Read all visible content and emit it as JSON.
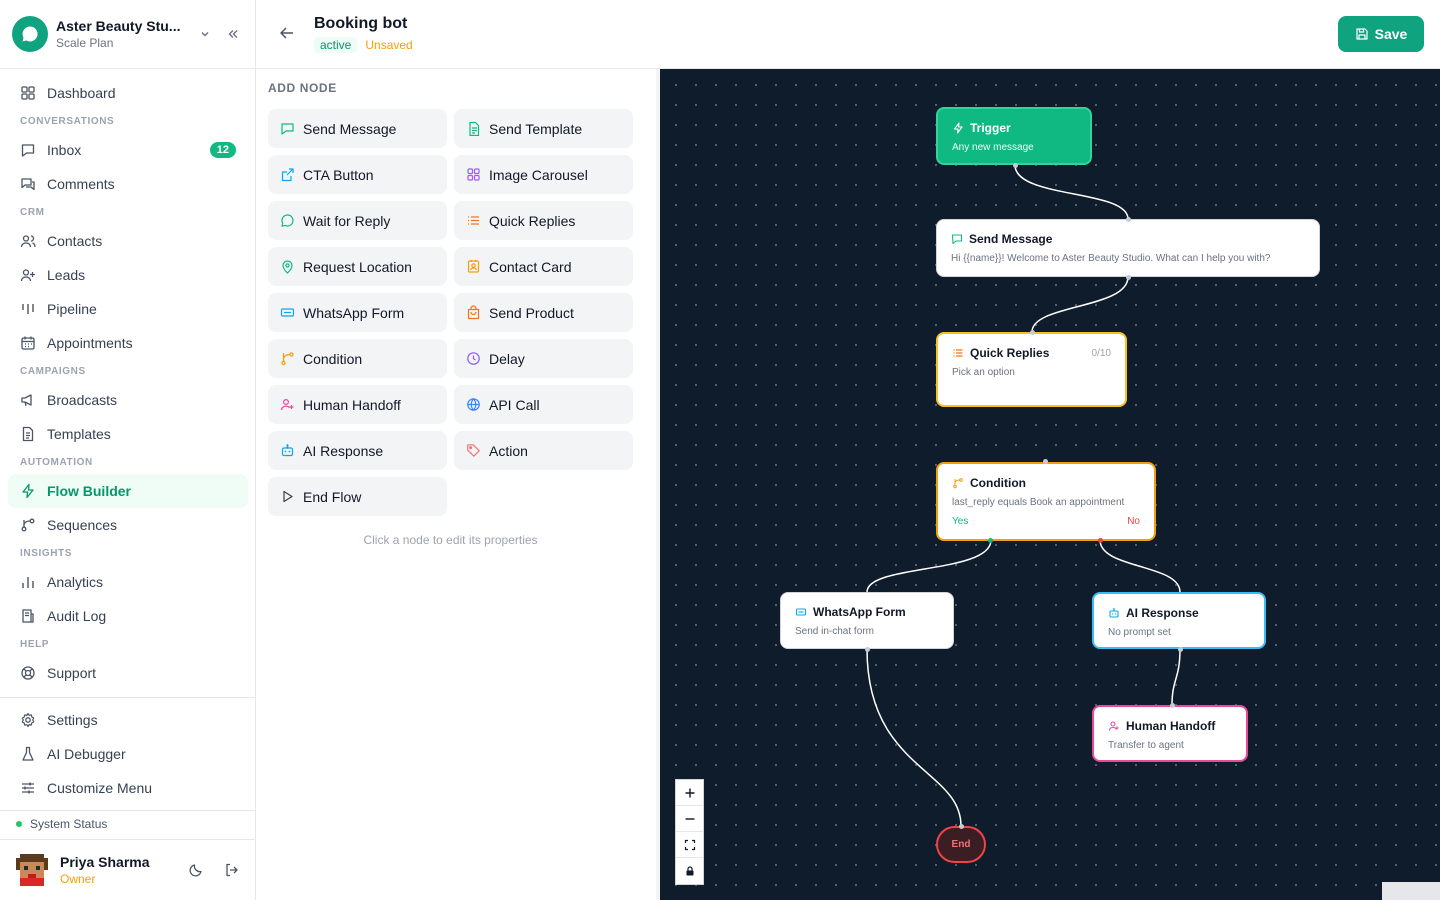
{
  "workspace": {
    "name": "Aster Beauty Stu...",
    "plan": "Scale Plan"
  },
  "nav": {
    "dashboard": "Dashboard",
    "sec_conversations": "CONVERSATIONS",
    "inbox": "Inbox",
    "inbox_badge": "12",
    "comments": "Comments",
    "sec_crm": "CRM",
    "contacts": "Contacts",
    "leads": "Leads",
    "pipeline": "Pipeline",
    "appointments": "Appointments",
    "sec_campaigns": "CAMPAIGNS",
    "broadcasts": "Broadcasts",
    "templates": "Templates",
    "sec_automation": "AUTOMATION",
    "flow_builder": "Flow Builder",
    "sequences": "Sequences",
    "sec_insights": "INSIGHTS",
    "analytics": "Analytics",
    "audit_log": "Audit Log",
    "sec_help": "HELP",
    "support": "Support",
    "settings": "Settings",
    "ai_debugger": "AI Debugger",
    "customize_menu": "Customize Menu"
  },
  "system_status": "System Status",
  "user": {
    "name": "Priya Sharma",
    "role": "Owner"
  },
  "header": {
    "title": "Booking bot",
    "status": "active",
    "unsaved": "Unsaved",
    "save": "Save"
  },
  "palette": {
    "title": "ADD NODE",
    "hint": "Click a node to edit its properties",
    "nodes": [
      {
        "label": "Send Message",
        "icon": "chat-icon",
        "color": "#10b981"
      },
      {
        "label": "Send Template",
        "icon": "document-icon",
        "color": "#10b981"
      },
      {
        "label": "CTA Button",
        "icon": "external-link-icon",
        "color": "#0ea5e9"
      },
      {
        "label": "Image Carousel",
        "icon": "grid-icon",
        "color": "#a855f7"
      },
      {
        "label": "Wait for Reply",
        "icon": "chat-bubble-icon",
        "color": "#10b981"
      },
      {
        "label": "Quick Replies",
        "icon": "list-icon",
        "color": "#f97316"
      },
      {
        "label": "Request Location",
        "icon": "location-pin-icon",
        "color": "#10b981"
      },
      {
        "label": "Contact Card",
        "icon": "contact-card-icon",
        "color": "#f59e0b"
      },
      {
        "label": "WhatsApp Form",
        "icon": "form-icon",
        "color": "#0ea5e9"
      },
      {
        "label": "Send Product",
        "icon": "shopping-bag-icon",
        "color": "#f97316"
      },
      {
        "label": "Condition",
        "icon": "branch-icon",
        "color": "#f59e0b"
      },
      {
        "label": "Delay",
        "icon": "clock-icon",
        "color": "#8b5cf6"
      },
      {
        "label": "Human Handoff",
        "icon": "user-handoff-icon",
        "color": "#ec4899"
      },
      {
        "label": "API Call",
        "icon": "globe-icon",
        "color": "#3b82f6"
      },
      {
        "label": "AI Response",
        "icon": "bot-icon",
        "color": "#0ea5e9"
      },
      {
        "label": "Action",
        "icon": "tag-icon",
        "color": "#f87171"
      },
      {
        "label": "End Flow",
        "icon": "play-icon",
        "color": "#374151"
      }
    ]
  },
  "flow": {
    "trigger": {
      "title": "Trigger",
      "sub": "Any new message"
    },
    "send_message": {
      "title": "Send Message",
      "sub": "Hi {{name}}! Welcome to Aster Beauty Studio. What can I help you with?"
    },
    "quick_replies": {
      "title": "Quick Replies",
      "count": "0/10",
      "sub": "Pick an option"
    },
    "condition": {
      "title": "Condition",
      "sub": "last_reply equals Book an appointment",
      "yes": "Yes",
      "no": "No"
    },
    "whatsapp_form": {
      "title": "WhatsApp Form",
      "sub": "Send in-chat form"
    },
    "ai_response": {
      "title": "AI Response",
      "sub": "No prompt set"
    },
    "human_handoff": {
      "title": "Human Handoff",
      "sub": "Transfer to agent"
    },
    "end": {
      "title": "End"
    }
  },
  "colors": {
    "brand": "#10a37f",
    "canvas": "#0f1c2b",
    "trigger": "#10b981",
    "quick_replies_border": "#fbbf24",
    "condition_border": "#f59e0b",
    "ai_border": "#38bdf8",
    "handoff_border": "#ec4899",
    "end_border": "#ef4444"
  }
}
